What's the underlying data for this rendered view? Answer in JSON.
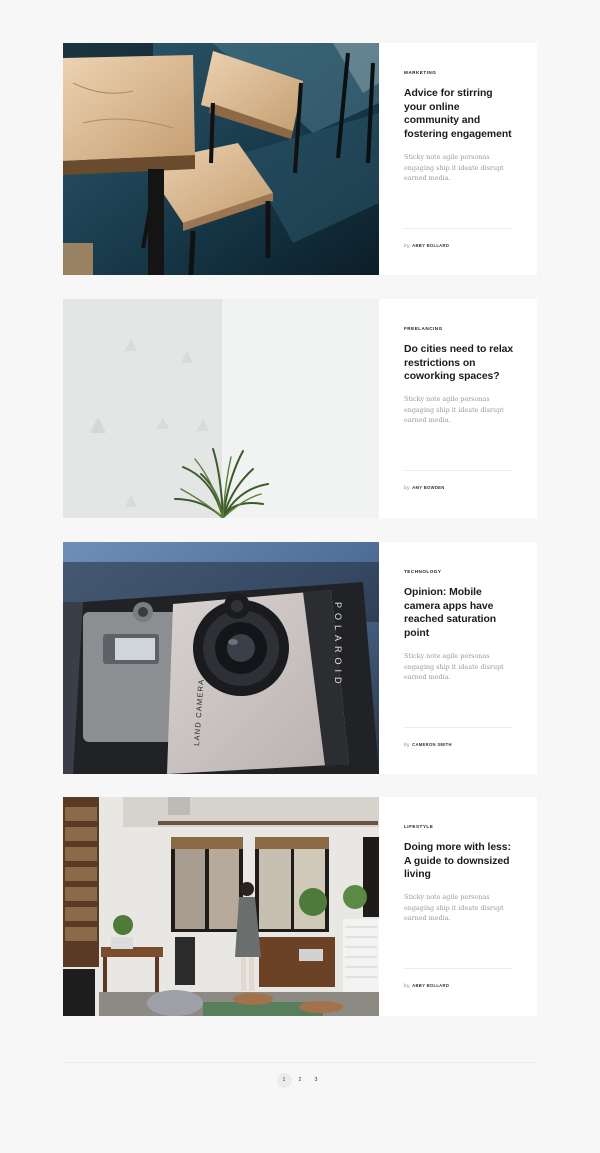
{
  "posts": [
    {
      "category": "Marketing",
      "title": "Advice for stirring your online community and fostering engagement",
      "excerpt": "Sticky note agile personas engaging ship it ideate disrupt earned media.",
      "by": "by",
      "author": "Abby Bollard",
      "image": "wooden-chairs-photo"
    },
    {
      "category": "Freelancing",
      "title": "Do cities need to relax restrictions on coworking spaces?",
      "excerpt": "Sticky note agile personas engaging ship it ideate disrupt earned media.",
      "by": "by",
      "author": "Amy Bowden",
      "image": "plant-corner-photo"
    },
    {
      "category": "Technology",
      "title": "Opinion: Mobile camera apps have reached saturation point",
      "excerpt": "Sticky note agile personas engaging ship it ideate disrupt earned media.",
      "by": "by",
      "author": "Cameron Smith",
      "image": "polaroid-camera-photo",
      "camera_brand": "POLAROID",
      "camera_model": "LAND CAMERA"
    },
    {
      "category": "Lifestyle",
      "title": "Doing more with less: A guide to downsized living",
      "excerpt": "Sticky note agile personas engaging ship it ideate disrupt earned media.",
      "by": "by",
      "author": "Abby Bollard",
      "image": "loft-interior-photo"
    }
  ],
  "pagination": {
    "prev": "←",
    "next": "→",
    "pages": [
      "1",
      "2",
      "3"
    ],
    "current": "1"
  },
  "colors": {
    "page_bg": "#f7f7f7",
    "card_bg": "#ffffff",
    "title": "#1b1b1b",
    "excerpt": "#9a9a9a"
  }
}
